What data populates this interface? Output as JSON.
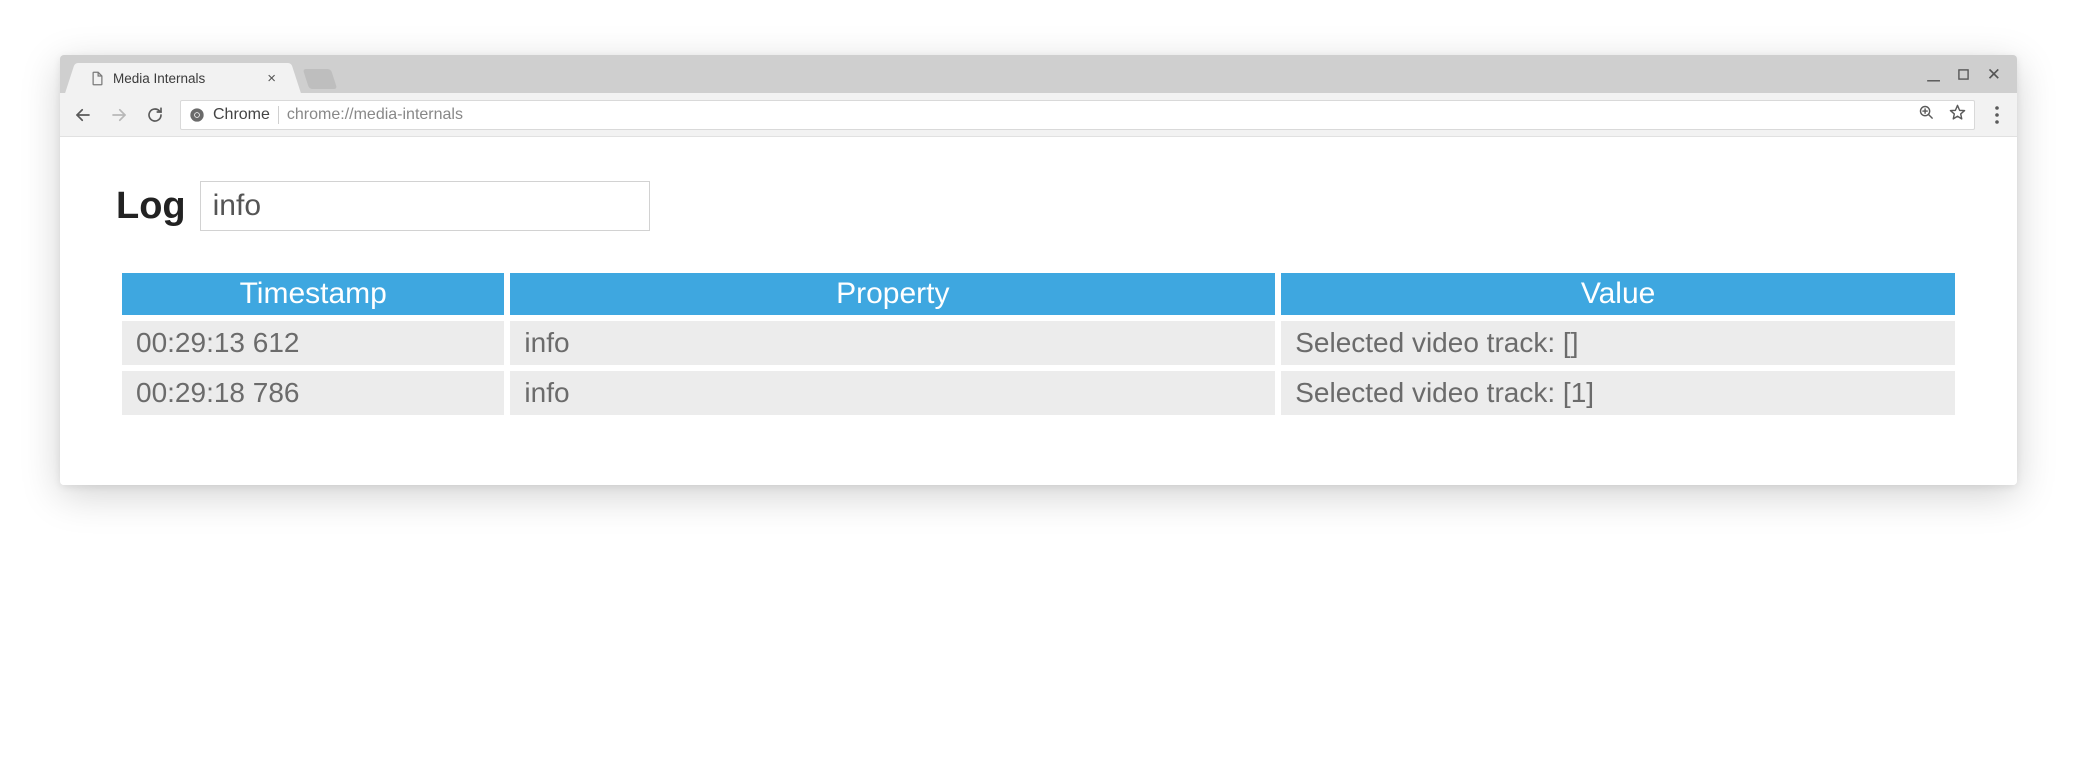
{
  "browser": {
    "tab_title": "Media Internals",
    "url_scheme_label": "Chrome",
    "url_path": "chrome://media-internals"
  },
  "page": {
    "heading": "Log",
    "filter_value": "info"
  },
  "table": {
    "headers": {
      "timestamp": "Timestamp",
      "property": "Property",
      "value": "Value"
    },
    "rows": [
      {
        "timestamp": "00:29:13 612",
        "property": "info",
        "value": "Selected video track: []"
      },
      {
        "timestamp": "00:29:18 786",
        "property": "info",
        "value": "Selected video track: [1]"
      }
    ]
  },
  "colors": {
    "header_blue": "#3EA7E0",
    "row_gray": "#ECECEC"
  }
}
